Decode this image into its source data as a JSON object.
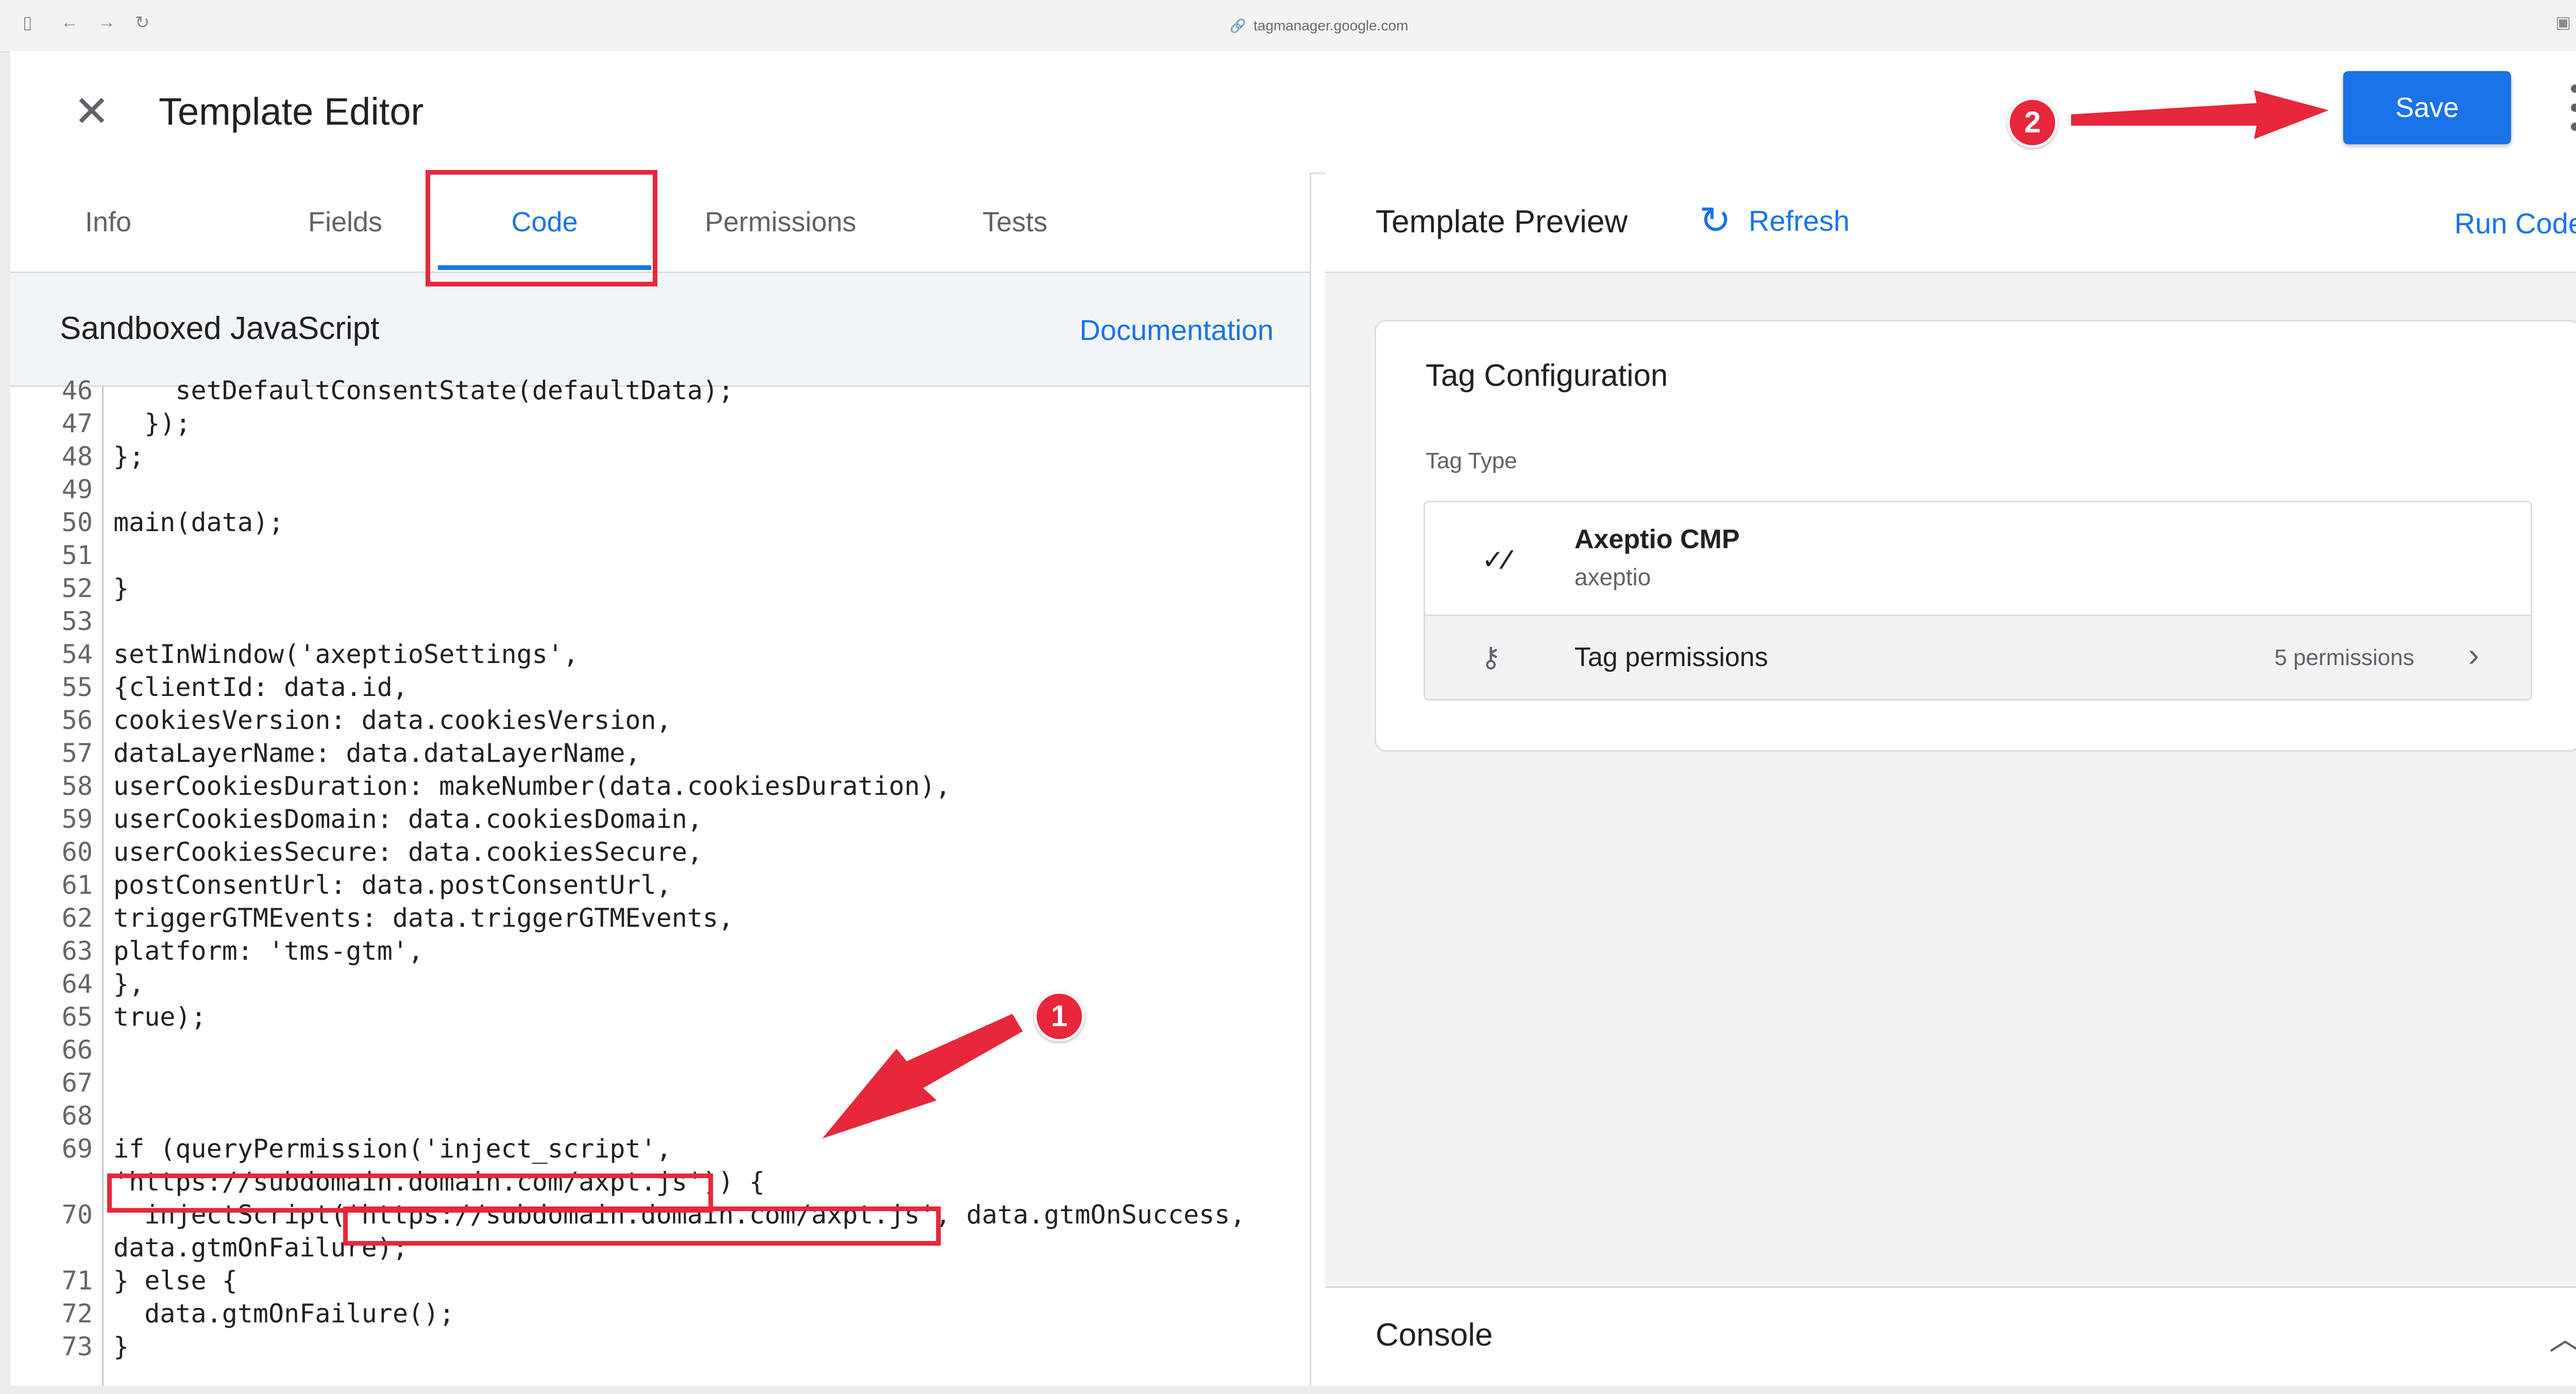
{
  "browser": {
    "url": "tagmanager.google.com"
  },
  "header": {
    "title": "Template Editor",
    "save_label": "Save"
  },
  "tabs": [
    {
      "label": "Info"
    },
    {
      "label": "Fields"
    },
    {
      "label": "Code"
    },
    {
      "label": "Permissions"
    },
    {
      "label": "Tests"
    }
  ],
  "active_tab": "Code",
  "code_panel": {
    "title": "Sandboxed JavaScript",
    "doc_link": "Documentation"
  },
  "code_lines": [
    {
      "n": "46",
      "text": "    setDefaultConsentState(defaultData);"
    },
    {
      "n": "47",
      "text": "  });"
    },
    {
      "n": "48",
      "text": "};"
    },
    {
      "n": "49",
      "text": ""
    },
    {
      "n": "50",
      "text": "main(data);"
    },
    {
      "n": "51",
      "text": ""
    },
    {
      "n": "52",
      "text": "}"
    },
    {
      "n": "53",
      "text": ""
    },
    {
      "n": "54",
      "text": "setInWindow('axeptioSettings',"
    },
    {
      "n": "55",
      "text": "{clientId: data.id,"
    },
    {
      "n": "56",
      "text": "cookiesVersion: data.cookiesVersion,"
    },
    {
      "n": "57",
      "text": "dataLayerName: data.dataLayerName,"
    },
    {
      "n": "58",
      "text": "userCookiesDuration: makeNumber(data.cookiesDuration),"
    },
    {
      "n": "59",
      "text": "userCookiesDomain: data.cookiesDomain,"
    },
    {
      "n": "60",
      "text": "userCookiesSecure: data.cookiesSecure,"
    },
    {
      "n": "61",
      "text": "postConsentUrl: data.postConsentUrl,"
    },
    {
      "n": "62",
      "text": "triggerGTMEvents: data.triggerGTMEvents,"
    },
    {
      "n": "63",
      "text": "platform: 'tms-gtm',"
    },
    {
      "n": "64",
      "text": "},"
    },
    {
      "n": "65",
      "text": "true);"
    },
    {
      "n": "66",
      "text": ""
    },
    {
      "n": "67",
      "text": ""
    },
    {
      "n": "68",
      "text": ""
    },
    {
      "n": "69",
      "text": "if (queryPermission('inject_script',"
    },
    {
      "n": "",
      "text": "'https://subdomain.domain.com/axpt.js')) {"
    },
    {
      "n": "70",
      "text": "  injectScript('https://subdomain.domain.com/axpt.js', data.gtmOnSuccess,"
    },
    {
      "n": "",
      "text": "data.gtmOnFailure);"
    },
    {
      "n": "71",
      "text": "} else {"
    },
    {
      "n": "72",
      "text": "  data.gtmOnFailure();"
    },
    {
      "n": "73",
      "text": "}"
    }
  ],
  "preview": {
    "title": "Template Preview",
    "refresh_label": "Refresh",
    "run_label": "Run Code"
  },
  "tag_config": {
    "title": "Tag Configuration",
    "type_label": "Tag Type",
    "tag_name": "Axeptio CMP",
    "tag_vendor": "axeptio",
    "permissions_label": "Tag permissions",
    "permissions_count": "5 permissions"
  },
  "console": {
    "label": "Console"
  },
  "annotations": {
    "badge_1": "1",
    "badge_2": "2",
    "color": "#e8273b"
  }
}
